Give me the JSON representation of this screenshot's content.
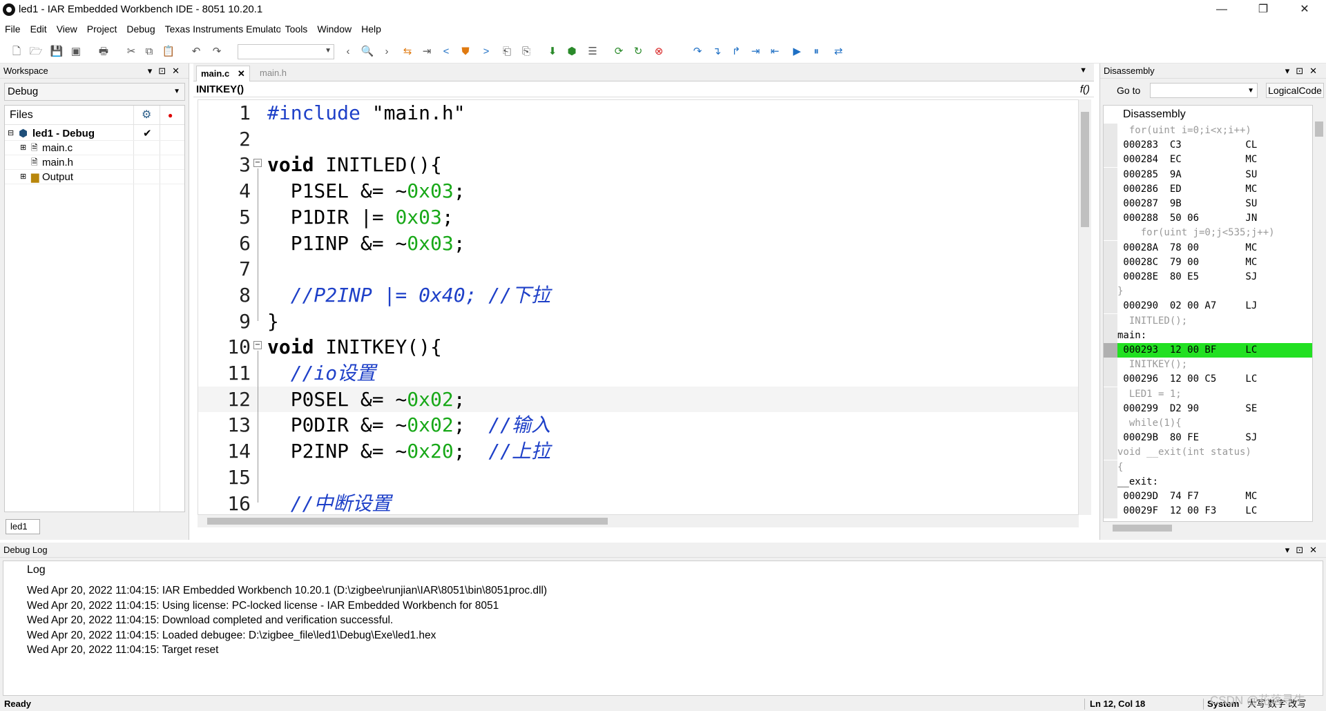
{
  "window": {
    "title": "led1 - IAR Embedded Workbench IDE - 8051 10.20.1",
    "controls": [
      "—",
      "❐",
      "✕"
    ]
  },
  "menu": [
    "File",
    "Edit",
    "View",
    "Project",
    "Debug",
    "Texas Instruments Emulator",
    "Tools",
    "Window",
    "Help"
  ],
  "workspace": {
    "title": "Workspace",
    "config": "Debug",
    "files_header": "Files",
    "tree": [
      {
        "label": "led1 - Debug",
        "bold": true,
        "check": "✔"
      },
      {
        "label": "main.c"
      },
      {
        "label": "main.h"
      },
      {
        "label": "Output"
      }
    ],
    "tab": "led1"
  },
  "editor": {
    "tabs": [
      "main.c",
      "main.h"
    ],
    "function": "INITKEY()",
    "lines": [
      {
        "n": "1",
        "html": "<span class=\"pp\">#include</span> \"main.h\""
      },
      {
        "n": "2",
        "html": ""
      },
      {
        "n": "3",
        "html": "<span class=\"kw\">void</span> INITLED(){",
        "fold": true
      },
      {
        "n": "4",
        "html": "  P1SEL &amp;= ~<span class=\"num\">0x03</span>;"
      },
      {
        "n": "5",
        "html": "  P1DIR |= <span class=\"num\">0x03</span>;"
      },
      {
        "n": "6",
        "html": "  P1INP &amp;= ~<span class=\"num\">0x03</span>;"
      },
      {
        "n": "7",
        "html": ""
      },
      {
        "n": "8",
        "html": "  <span class=\"cm\">//P2INP |= 0x40; //下拉</span>"
      },
      {
        "n": "9",
        "html": "}"
      },
      {
        "n": "10",
        "html": "<span class=\"kw\">void</span> INITKEY(){",
        "fold": true
      },
      {
        "n": "11",
        "html": "  <span class=\"cm\">//io设置</span>"
      },
      {
        "n": "12",
        "html": "  P0SEL &amp;= ~<span class=\"num\">0x02</span>;",
        "current": true
      },
      {
        "n": "13",
        "html": "  P0DIR &amp;= ~<span class=\"num\">0x02</span>;  <span class=\"cm\">//输入</span>"
      },
      {
        "n": "14",
        "html": "  P2INP &amp;= ~<span class=\"num\">0x20</span>;  <span class=\"cm\">//上拉</span>"
      },
      {
        "n": "15",
        "html": ""
      },
      {
        "n": "16",
        "html": "  <span class=\"cm\">//中断设置</span>"
      }
    ]
  },
  "disassembly": {
    "title": "Disassembly",
    "goto_label": "Go to",
    "logical_code": "LogicalCode",
    "header": "Disassembly",
    "lines": [
      {
        "t": "src",
        "text": "  for(uint i=0;i<x;i++)"
      },
      {
        "t": "asm",
        "text": " 000283  C3           CL"
      },
      {
        "t": "asm",
        "text": " 000284  EC           MC"
      },
      {
        "t": "asm",
        "text": " 000285  9A           SU"
      },
      {
        "t": "asm",
        "text": " 000286  ED           MC"
      },
      {
        "t": "asm",
        "text": " 000287  9B           SU"
      },
      {
        "t": "asm",
        "text": " 000288  50 06        JN"
      },
      {
        "t": "src",
        "text": "    for(uint j=0;j<535;j++)"
      },
      {
        "t": "asm",
        "text": " 00028A  78 00        MC"
      },
      {
        "t": "asm",
        "text": " 00028C  79 00        MC"
      },
      {
        "t": "asm",
        "text": " 00028E  80 E5        SJ"
      },
      {
        "t": "src",
        "text": "}"
      },
      {
        "t": "asm",
        "text": " 000290  02 00 A7     LJ"
      },
      {
        "t": "src",
        "text": "  INITLED();"
      },
      {
        "t": "lbl",
        "text": "main:"
      },
      {
        "t": "hl",
        "text": " 000293  12 00 BF     LC"
      },
      {
        "t": "src",
        "text": "  INITKEY();"
      },
      {
        "t": "asm",
        "text": " 000296  12 00 C5     LC"
      },
      {
        "t": "src",
        "text": "  LED1 = 1;"
      },
      {
        "t": "asm",
        "text": " 000299  D2 90        SE"
      },
      {
        "t": "src",
        "text": "  while(1){"
      },
      {
        "t": "asm",
        "text": " 00029B  80 FE        SJ"
      },
      {
        "t": "src",
        "text": "void __exit(int status)"
      },
      {
        "t": "src",
        "text": "{"
      },
      {
        "t": "lbl",
        "text": "__exit:"
      },
      {
        "t": "asm",
        "text": " 00029D  74 F7        MC"
      },
      {
        "t": "asm",
        "text": " 00029F  12 00 F3     LC"
      }
    ]
  },
  "log": {
    "title": "Debug Log",
    "header": "Log",
    "lines": [
      "Wed Apr 20, 2022 11:04:15: IAR Embedded Workbench 10.20.1 (D:\\zigbee\\runjian\\IAR\\8051\\bin\\8051proc.dll)",
      "Wed Apr 20, 2022 11:04:15: Using license: PC-locked license - IAR Embedded Workbench for 8051",
      "Wed Apr 20, 2022 11:04:15: Download completed and verification successful.",
      "Wed Apr 20, 2022 11:04:15: Loaded debugee: D:\\zigbee_file\\led1\\Debug\\Exe\\led1.hex",
      "Wed Apr 20, 2022 11:04:15: Target reset"
    ]
  },
  "status": {
    "ready": "Ready",
    "position": "Ln 12, Col 18",
    "system": "System",
    "ime": "大写 数字 改写"
  },
  "watermark": "CSDN @花落寻牛"
}
